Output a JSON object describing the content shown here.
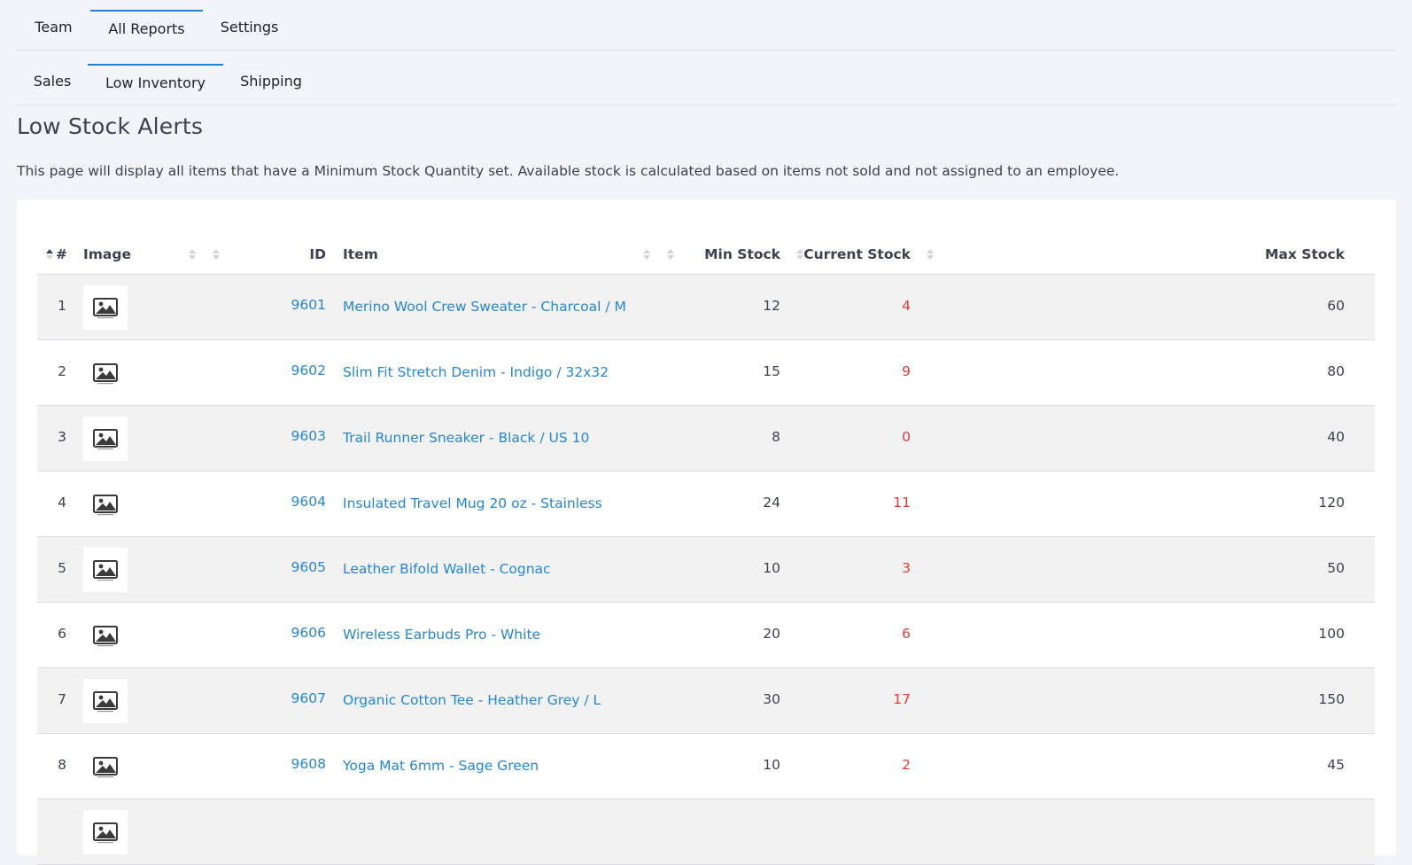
{
  "primary_tabs": [
    {
      "label": "Team",
      "active": false
    },
    {
      "label": "All Reports",
      "active": true
    },
    {
      "label": "Settings",
      "active": false
    }
  ],
  "secondary_tabs": [
    {
      "label": "Sales",
      "active": false
    },
    {
      "label": "Low Inventory",
      "active": true
    },
    {
      "label": "Shipping",
      "active": false
    }
  ],
  "page": {
    "title": "Low Stock Alerts",
    "description": "This page will display all items that have a Minimum Stock Quantity set. Available stock is calculated based on items not sold and not assigned to an employee."
  },
  "table": {
    "headers": {
      "num": "#",
      "image": "Image",
      "id": "ID",
      "item": "Item",
      "min_stock": "Min Stock",
      "current_stock": "Current Stock",
      "max_stock": "Max Stock"
    },
    "placeholder_icon": "image-placeholder-icon",
    "current_stock_color": "#e53935",
    "link_color": "#2686cf",
    "rows": [
      {
        "num": "1",
        "id": "9601",
        "item": "Merino Wool Crew Sweater - Charcoal / M",
        "min": "12",
        "current": "4",
        "max": "60"
      },
      {
        "num": "2",
        "id": "9602",
        "item": "Slim Fit Stretch Denim - Indigo / 32x32",
        "min": "15",
        "current": "9",
        "max": "80"
      },
      {
        "num": "3",
        "id": "9603",
        "item": "Trail Runner Sneaker - Black / US 10",
        "min": "8",
        "current": "0",
        "max": "40"
      },
      {
        "num": "4",
        "id": "9604",
        "item": "Insulated Travel Mug 20 oz - Stainless",
        "min": "24",
        "current": "11",
        "max": "120"
      },
      {
        "num": "5",
        "id": "9605",
        "item": "Leather Bifold Wallet - Cognac",
        "min": "10",
        "current": "3",
        "max": "50"
      },
      {
        "num": "6",
        "id": "9606",
        "item": "Wireless Earbuds Pro - White",
        "min": "20",
        "current": "6",
        "max": "100"
      },
      {
        "num": "7",
        "id": "9607",
        "item": "Organic Cotton Tee - Heather Grey / L",
        "min": "30",
        "current": "17",
        "max": "150"
      },
      {
        "num": "8",
        "id": "9608",
        "item": "Yoga Mat 6mm - Sage Green",
        "min": "10",
        "current": "2",
        "max": "45"
      }
    ]
  }
}
